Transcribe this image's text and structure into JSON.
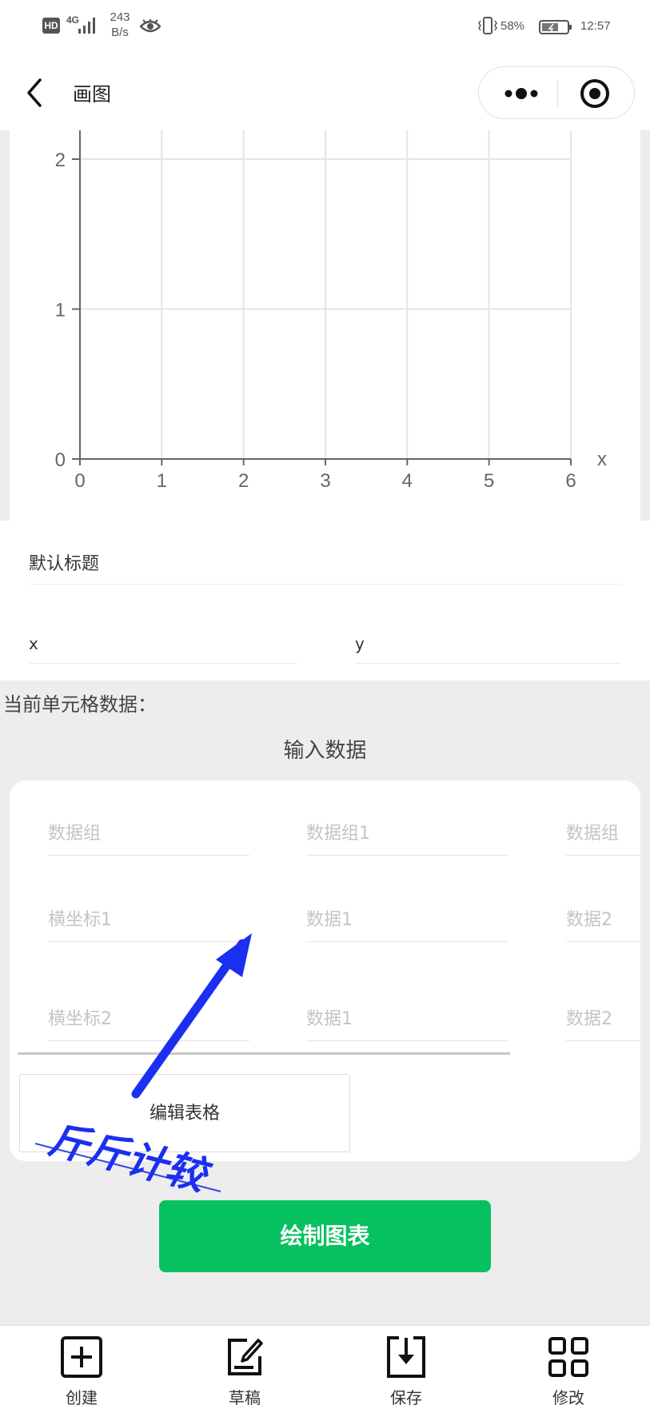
{
  "status_bar": {
    "hd": "HD",
    "network": "4G",
    "speed_value": "243",
    "speed_unit": "B/s",
    "battery_pct": "58%",
    "time": "12:57"
  },
  "nav": {
    "title": "画图"
  },
  "chart_data": {
    "type": "line",
    "title": "",
    "xlabel": "x",
    "ylabel": "",
    "xlim": [
      0,
      6
    ],
    "ylim": [
      0,
      2
    ],
    "x_ticks": [
      "0",
      "1",
      "2",
      "3",
      "4",
      "5",
      "6"
    ],
    "y_ticks": [
      "0",
      "1",
      "2"
    ],
    "series": [],
    "grid": true
  },
  "form": {
    "chart_title": "默认标题",
    "x_label": "x",
    "y_label": "y"
  },
  "current_cell_label": "当前单元格数据：",
  "input_label": "输入数据",
  "table": {
    "rows": [
      [
        "数据组",
        "数据组1",
        "数据组"
      ],
      [
        "横坐标1",
        "数据1",
        "数据2"
      ],
      [
        "横坐标2",
        "数据1",
        "数据2"
      ]
    ]
  },
  "edit_table_label": "编辑表格",
  "watermark_text": "斤斤计较",
  "draw_button_label": "绘制图表",
  "tabs": [
    {
      "label": "创建",
      "icon": "add-square-icon"
    },
    {
      "label": "草稿",
      "icon": "draft-edit-icon"
    },
    {
      "label": "保存",
      "icon": "save-download-icon"
    },
    {
      "label": "修改",
      "icon": "grid-apps-icon"
    }
  ]
}
